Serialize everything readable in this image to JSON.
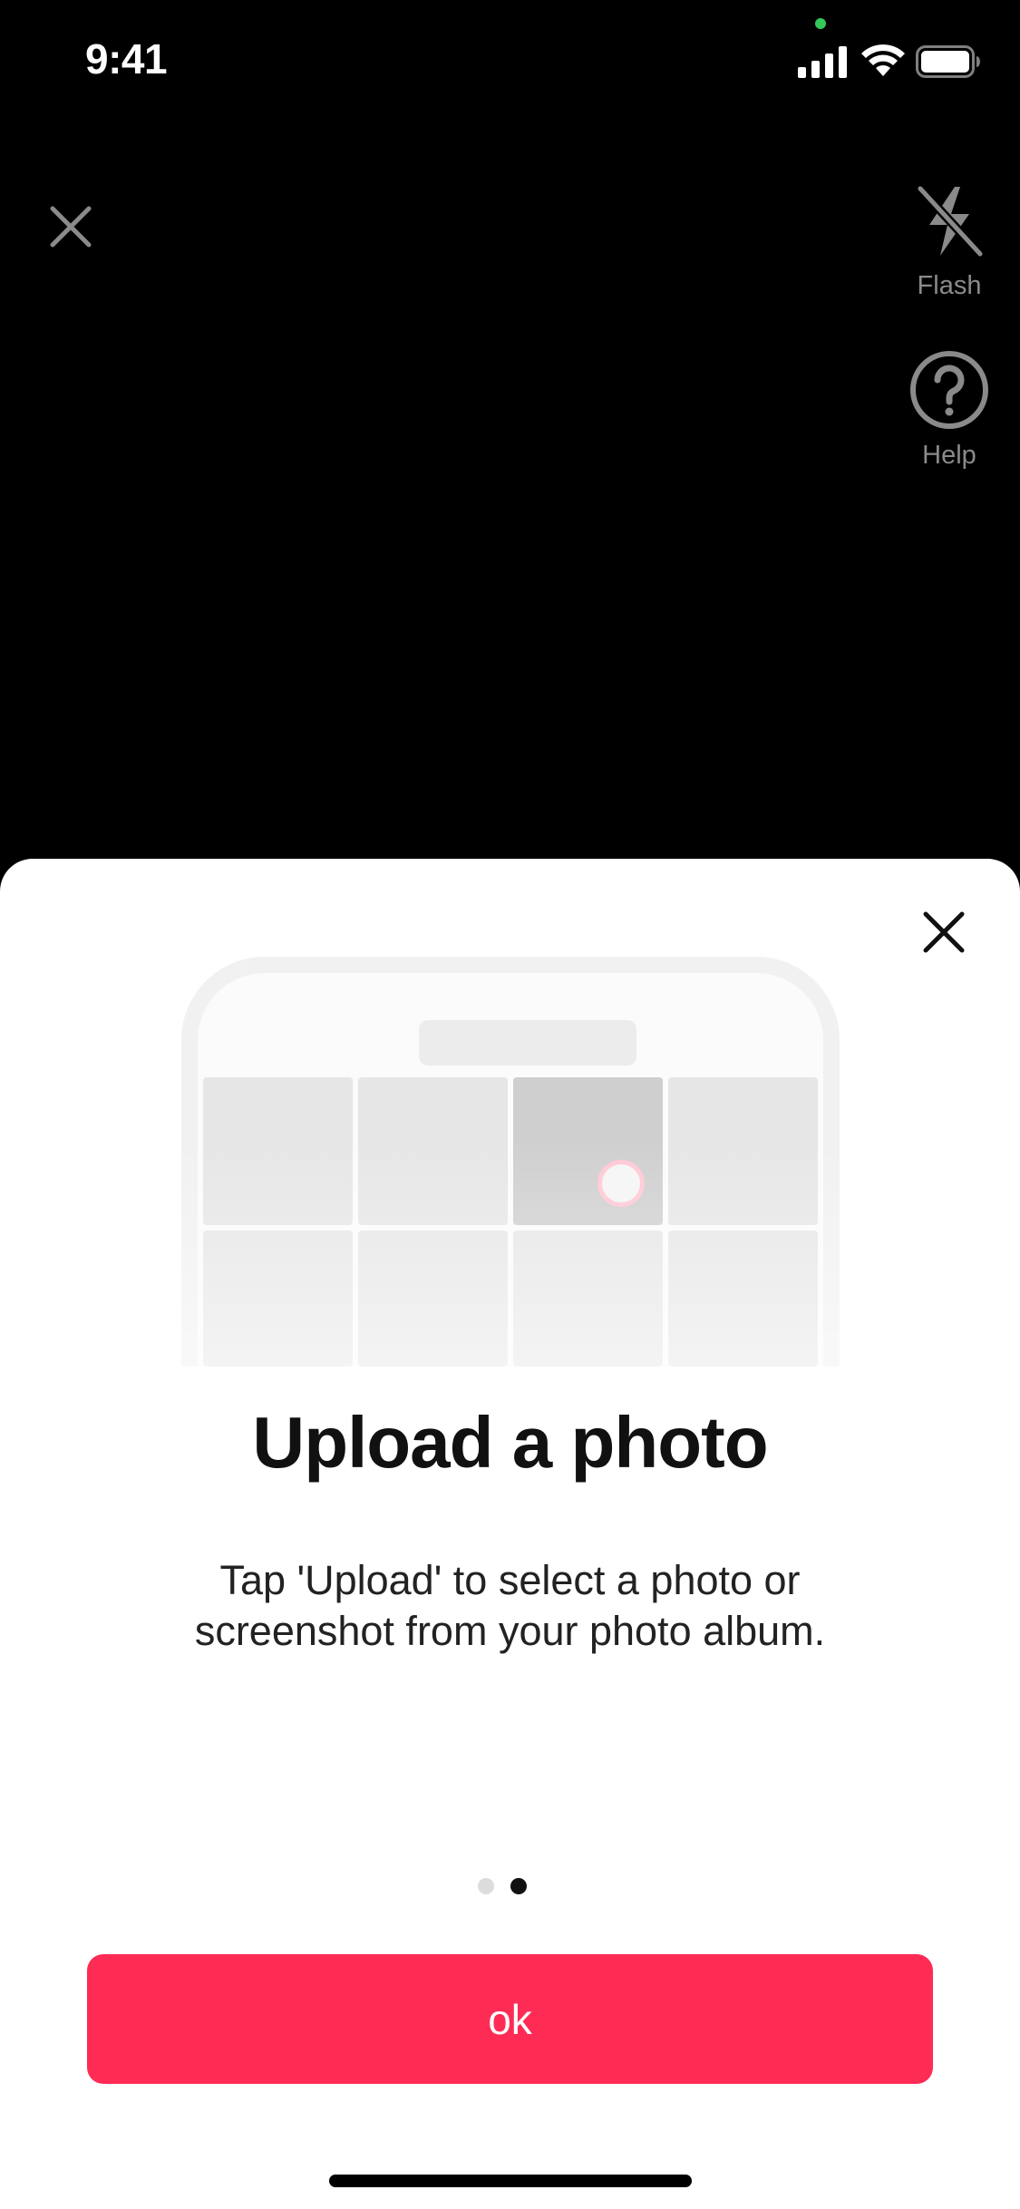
{
  "status_bar": {
    "time": "9:41"
  },
  "camera": {
    "close_icon": "close-icon",
    "flash": {
      "icon": "flash-off-icon",
      "label": "Flash"
    },
    "help": {
      "icon": "help-icon",
      "label": "Help"
    }
  },
  "sheet": {
    "close_icon": "close-icon",
    "title": "Upload a photo",
    "description": "Tap 'Upload' to select a photo or screenshot from your photo album.",
    "page_count": 2,
    "active_page": 2,
    "ok_label": "ok"
  },
  "colors": {
    "accent": "#fe2c55",
    "camera_background": "#000000",
    "sheet_background": "#ffffff",
    "muted_icon": "#8a8a8a"
  }
}
